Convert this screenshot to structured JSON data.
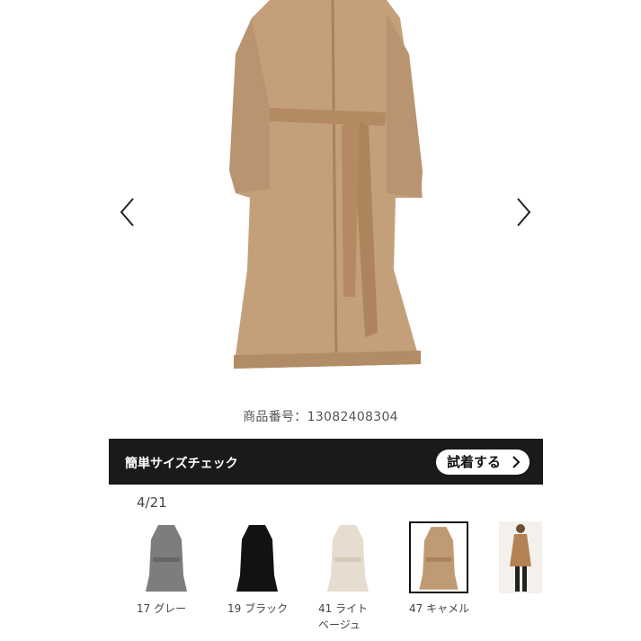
{
  "product": {
    "number_label": "商品番号：13082408304"
  },
  "size_check": {
    "label": "簡単サイズチェック",
    "button_label": "試着する"
  },
  "gallery": {
    "counter": "4/21"
  },
  "colors": {
    "items": [
      {
        "label": "17 グレー",
        "swatch": "#7d7d7d"
      },
      {
        "label": "19 ブラック",
        "swatch": "#121212"
      },
      {
        "label": "41 ライトベージュ",
        "swatch": "#e6dcd0"
      },
      {
        "label": "47 キャメル",
        "swatch": "#c09a72",
        "selected": true
      },
      {
        "label": "",
        "swatch": "#b48255"
      }
    ]
  },
  "theme": {
    "camel": "#c4a07a",
    "camel_dark": "#a98259",
    "bar_bg": "#1a1a1a"
  }
}
